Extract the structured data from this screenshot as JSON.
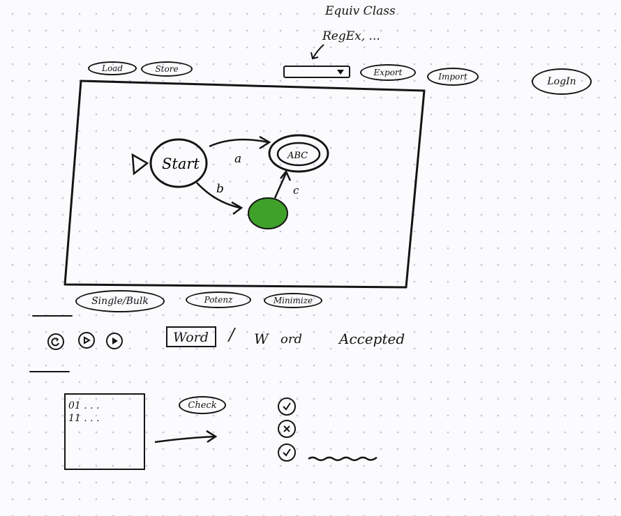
{
  "annotation": {
    "line1": "Equiv Class",
    "line2": "RegEx, ..."
  },
  "toolbar": {
    "load_label": "Load",
    "store_label": "Store",
    "export_label": "Export",
    "import_label": "Import",
    "login_label": "LogIn",
    "dropdown_value": "",
    "dropdown_icon": "triangle-down-icon"
  },
  "automaton": {
    "start_state_label": "Start",
    "accept_state_label": "ABC",
    "transition_a": "a",
    "transition_b": "b",
    "transition_c": "c",
    "active_state_color": "#3fa12a"
  },
  "mode_buttons": {
    "single_bulk_label": "Single/Bulk",
    "potenz_label": "Potenz",
    "minimize_label": "Minimize"
  },
  "word_check": {
    "controls": [
      "reset-icon",
      "step-icon",
      "play-icon"
    ],
    "word_field": "Word",
    "separator": "/",
    "word_letter": "W",
    "word_rest": "ord",
    "result": "Accepted"
  },
  "bulk": {
    "lines": [
      "01 . . .",
      "11 . . ."
    ],
    "check_label": "Check",
    "results": [
      "check-icon",
      "cross-icon",
      "check-icon"
    ]
  }
}
